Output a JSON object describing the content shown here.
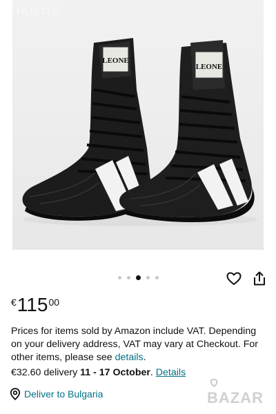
{
  "product_image": {
    "brand_text": "LEONE",
    "top_watermark": "HUSTLE",
    "carousel": {
      "count": 5,
      "active_index": 2
    }
  },
  "actions": {
    "heart_icon": "heart-outline-icon",
    "share_icon": "share-icon"
  },
  "price": {
    "currency": "€",
    "whole": "115",
    "fraction": "00"
  },
  "vat_notice": {
    "text": "Prices for items sold by Amazon include VAT. Depending on your delivery address, VAT may vary at Checkout. For other items, please see ",
    "link_label": "details",
    "trailing": "."
  },
  "delivery": {
    "price_text": "€32.60 delivery ",
    "dates": "11 - 17 October",
    "separator": ". ",
    "details_label": "Details"
  },
  "deliver_to": {
    "label": "Deliver to Bulgaria",
    "icon": "location-pin-icon"
  },
  "watermark": {
    "text": "BAZAR"
  },
  "colors": {
    "link": "#007185",
    "text": "#0f1111"
  }
}
